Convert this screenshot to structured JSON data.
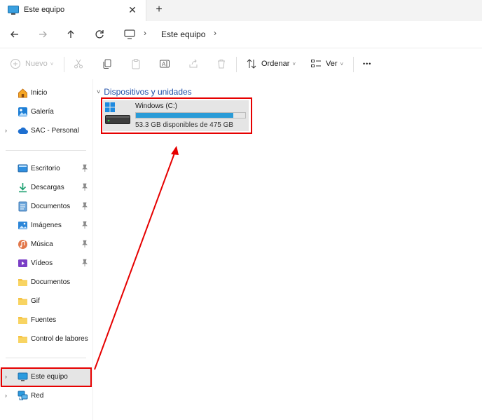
{
  "window": {
    "tab_title": "Este equipo",
    "close_tab_glyph": "✕",
    "new_tab_glyph": "+"
  },
  "address_bar": {
    "location": "Este equipo",
    "icons": [
      "arrow-left-icon",
      "arrow-right-icon",
      "arrow-up-icon",
      "refresh-icon",
      "computer-icon"
    ]
  },
  "toolbar": {
    "new_label": "Nuevo",
    "sort_label": "Ordenar",
    "view_label": "Ver",
    "more_glyph": "•••"
  },
  "sidebar": {
    "top": [
      {
        "label": "Inicio",
        "icon": "home-icon"
      },
      {
        "label": "Galería",
        "icon": "gallery-icon"
      },
      {
        "label": "SAC - Personal",
        "icon": "cloud-icon"
      }
    ],
    "quick_access": [
      {
        "label": "Escritorio",
        "icon": "desktop-icon",
        "pinned": true
      },
      {
        "label": "Descargas",
        "icon": "download-icon",
        "pinned": true
      },
      {
        "label": "Documentos",
        "icon": "documents-icon",
        "pinned": true
      },
      {
        "label": "Imágenes",
        "icon": "pictures-icon",
        "pinned": true
      },
      {
        "label": "Música",
        "icon": "music-icon",
        "pinned": true
      },
      {
        "label": "Vídeos",
        "icon": "videos-icon",
        "pinned": true
      },
      {
        "label": "Documentos",
        "icon": "folder-icon",
        "pinned": false
      },
      {
        "label": "Gif",
        "icon": "folder-icon",
        "pinned": false
      },
      {
        "label": "Fuentes",
        "icon": "folder-icon",
        "pinned": false
      },
      {
        "label": "Control de labores",
        "icon": "folder-icon",
        "pinned": false
      }
    ],
    "bottom": [
      {
        "label": "Este equipo",
        "icon": "computer-icon",
        "selected": true
      },
      {
        "label": "Red",
        "icon": "network-icon",
        "selected": false
      }
    ]
  },
  "content": {
    "group_title": "Dispositivos y unidades",
    "drives": [
      {
        "name": "Windows (C:)",
        "free_text": "53.3 GB disponibles de 475 GB",
        "used_fraction": 0.888
      }
    ]
  },
  "colors": {
    "accent": "#2a9bd7",
    "group_header": "#1f4fa8",
    "annotation_red": "#e60000",
    "selected_bg": "#e5e5e5"
  }
}
